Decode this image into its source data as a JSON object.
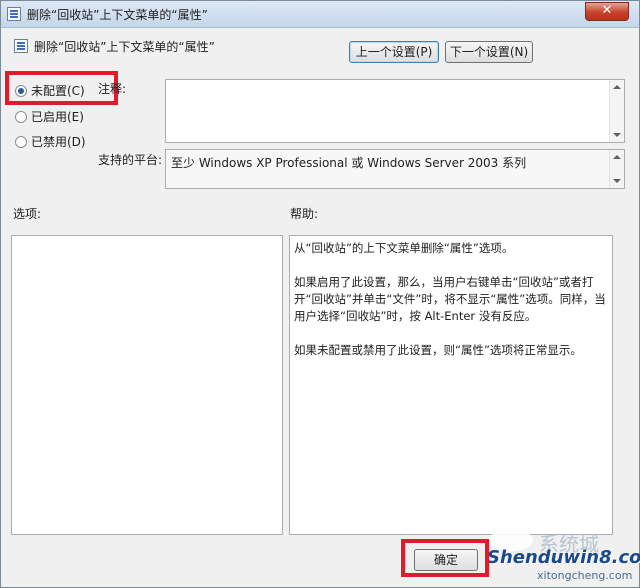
{
  "window": {
    "title": "删除“回收站”上下文菜单的“属性”",
    "close_glyph": "✕"
  },
  "header": {
    "title": "删除“回收站”上下文菜单的“属性”",
    "prev_button": "上一个设置(P)",
    "next_button": "下一个设置(N)"
  },
  "radios": [
    {
      "label": "未配置(C)",
      "checked": true
    },
    {
      "label": "已启用(E)",
      "checked": false
    },
    {
      "label": "已禁用(D)",
      "checked": false
    }
  ],
  "comment": {
    "label": "注释:",
    "value": ""
  },
  "platform": {
    "label": "支持的平台:",
    "value": "至少 Windows XP Professional 或 Windows Server 2003 系列"
  },
  "options": {
    "label": "选项:"
  },
  "help": {
    "label": "帮助:",
    "paragraphs": [
      "从“回收站”的上下文菜单删除“属性”选项。",
      "如果启用了此设置，那么，当用户右键单击“回收站”或者打开“回收站”并单击“文件”时，将不显示“属性”选项。同样，当用户选择“回收站”时，按 Alt-Enter 没有反应。",
      "如果未配置或禁用了此设置，则“属性”选项将正常显示。"
    ]
  },
  "footer": {
    "ok_button": "确定"
  },
  "watermark": {
    "site": "Shenduwin8.com",
    "site2": "xitongcheng.com",
    "cjk": "系统城"
  },
  "colors": {
    "highlight": "#e21b2c"
  }
}
